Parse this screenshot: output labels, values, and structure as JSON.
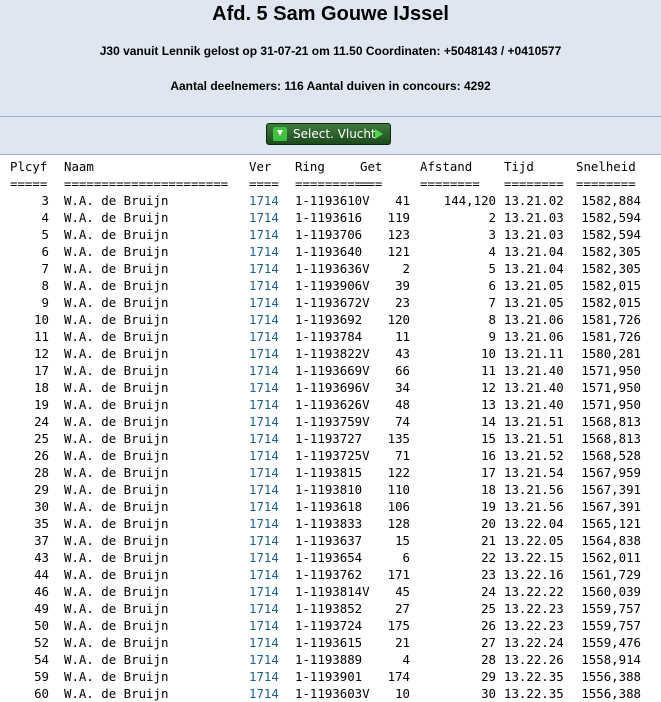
{
  "header": {
    "title": "Afd. 5 Sam Gouwe IJssel",
    "flight_info": "J30 vanuit Lennik gelost op 31-07-21 om 11.50 Coordinaten: +5048143 / +0410577",
    "participants": "Aantal deelnemers: 116 Aantal duiven in concours: 4292"
  },
  "toolbar": {
    "select_label": "Select. Vlucht"
  },
  "table": {
    "columns": [
      "Plcyf",
      "Naam",
      "Ver",
      "Ring",
      "Get",
      "Afstand",
      "Tijd",
      "Snelheid"
    ],
    "separators": [
      "=====",
      "======================",
      "====",
      "==========",
      "===",
      "========",
      "========",
      "========"
    ],
    "rows": [
      [
        "3",
        "W.A. de Bruijn",
        "1714",
        "1-1193610V",
        "41",
        "144,120",
        "13.21.02",
        "1582,884"
      ],
      [
        "4",
        "W.A. de Bruijn",
        "1714",
        "1-1193616",
        "119",
        "2",
        "13.21.03",
        "1582,594"
      ],
      [
        "5",
        "W.A. de Bruijn",
        "1714",
        "1-1193706",
        "123",
        "3",
        "13.21.03",
        "1582,594"
      ],
      [
        "6",
        "W.A. de Bruijn",
        "1714",
        "1-1193640",
        "121",
        "4",
        "13.21.04",
        "1582,305"
      ],
      [
        "7",
        "W.A. de Bruijn",
        "1714",
        "1-1193636V",
        "2",
        "5",
        "13.21.04",
        "1582,305"
      ],
      [
        "8",
        "W.A. de Bruijn",
        "1714",
        "1-1193906V",
        "39",
        "6",
        "13.21.05",
        "1582,015"
      ],
      [
        "9",
        "W.A. de Bruijn",
        "1714",
        "1-1193672V",
        "23",
        "7",
        "13.21.05",
        "1582,015"
      ],
      [
        "10",
        "W.A. de Bruijn",
        "1714",
        "1-1193692",
        "120",
        "8",
        "13.21.06",
        "1581,726"
      ],
      [
        "11",
        "W.A. de Bruijn",
        "1714",
        "1-1193784",
        "11",
        "9",
        "13.21.06",
        "1581,726"
      ],
      [
        "12",
        "W.A. de Bruijn",
        "1714",
        "1-1193822V",
        "43",
        "10",
        "13.21.11",
        "1580,281"
      ],
      [
        "17",
        "W.A. de Bruijn",
        "1714",
        "1-1193669V",
        "66",
        "11",
        "13.21.40",
        "1571,950"
      ],
      [
        "18",
        "W.A. de Bruijn",
        "1714",
        "1-1193696V",
        "34",
        "12",
        "13.21.40",
        "1571,950"
      ],
      [
        "19",
        "W.A. de Bruijn",
        "1714",
        "1-1193626V",
        "48",
        "13",
        "13.21.40",
        "1571,950"
      ],
      [
        "24",
        "W.A. de Bruijn",
        "1714",
        "1-1193759V",
        "74",
        "14",
        "13.21.51",
        "1568,813"
      ],
      [
        "25",
        "W.A. de Bruijn",
        "1714",
        "1-1193727",
        "135",
        "15",
        "13.21.51",
        "1568,813"
      ],
      [
        "26",
        "W.A. de Bruijn",
        "1714",
        "1-1193725V",
        "71",
        "16",
        "13.21.52",
        "1568,528"
      ],
      [
        "28",
        "W.A. de Bruijn",
        "1714",
        "1-1193815",
        "122",
        "17",
        "13.21.54",
        "1567,959"
      ],
      [
        "29",
        "W.A. de Bruijn",
        "1714",
        "1-1193810",
        "110",
        "18",
        "13.21.56",
        "1567,391"
      ],
      [
        "30",
        "W.A. de Bruijn",
        "1714",
        "1-1193618",
        "106",
        "19",
        "13.21.56",
        "1567,391"
      ],
      [
        "35",
        "W.A. de Bruijn",
        "1714",
        "1-1193833",
        "128",
        "20",
        "13.22.04",
        "1565,121"
      ],
      [
        "37",
        "W.A. de Bruijn",
        "1714",
        "1-1193637",
        "15",
        "21",
        "13.22.05",
        "1564,838"
      ],
      [
        "43",
        "W.A. de Bruijn",
        "1714",
        "1-1193654",
        "6",
        "22",
        "13.22.15",
        "1562,011"
      ],
      [
        "44",
        "W.A. de Bruijn",
        "1714",
        "1-1193762",
        "171",
        "23",
        "13.22.16",
        "1561,729"
      ],
      [
        "46",
        "W.A. de Bruijn",
        "1714",
        "1-1193814V",
        "45",
        "24",
        "13.22.22",
        "1560,039"
      ],
      [
        "49",
        "W.A. de Bruijn",
        "1714",
        "1-1193852",
        "27",
        "25",
        "13.22.23",
        "1559,757"
      ],
      [
        "50",
        "W.A. de Bruijn",
        "1714",
        "1-1193724",
        "175",
        "26",
        "13.22.23",
        "1559,757"
      ],
      [
        "52",
        "W.A. de Bruijn",
        "1714",
        "1-1193615",
        "21",
        "27",
        "13.22.24",
        "1559,476"
      ],
      [
        "54",
        "W.A. de Bruijn",
        "1714",
        "1-1193889",
        "4",
        "28",
        "13.22.26",
        "1558,914"
      ],
      [
        "59",
        "W.A. de Bruijn",
        "1714",
        "1-1193901",
        "174",
        "29",
        "13.22.35",
        "1556,388"
      ],
      [
        "60",
        "W.A. de Bruijn",
        "1714",
        "1-1193603V",
        "10",
        "30",
        "13.22.35",
        "1556,388"
      ]
    ]
  }
}
